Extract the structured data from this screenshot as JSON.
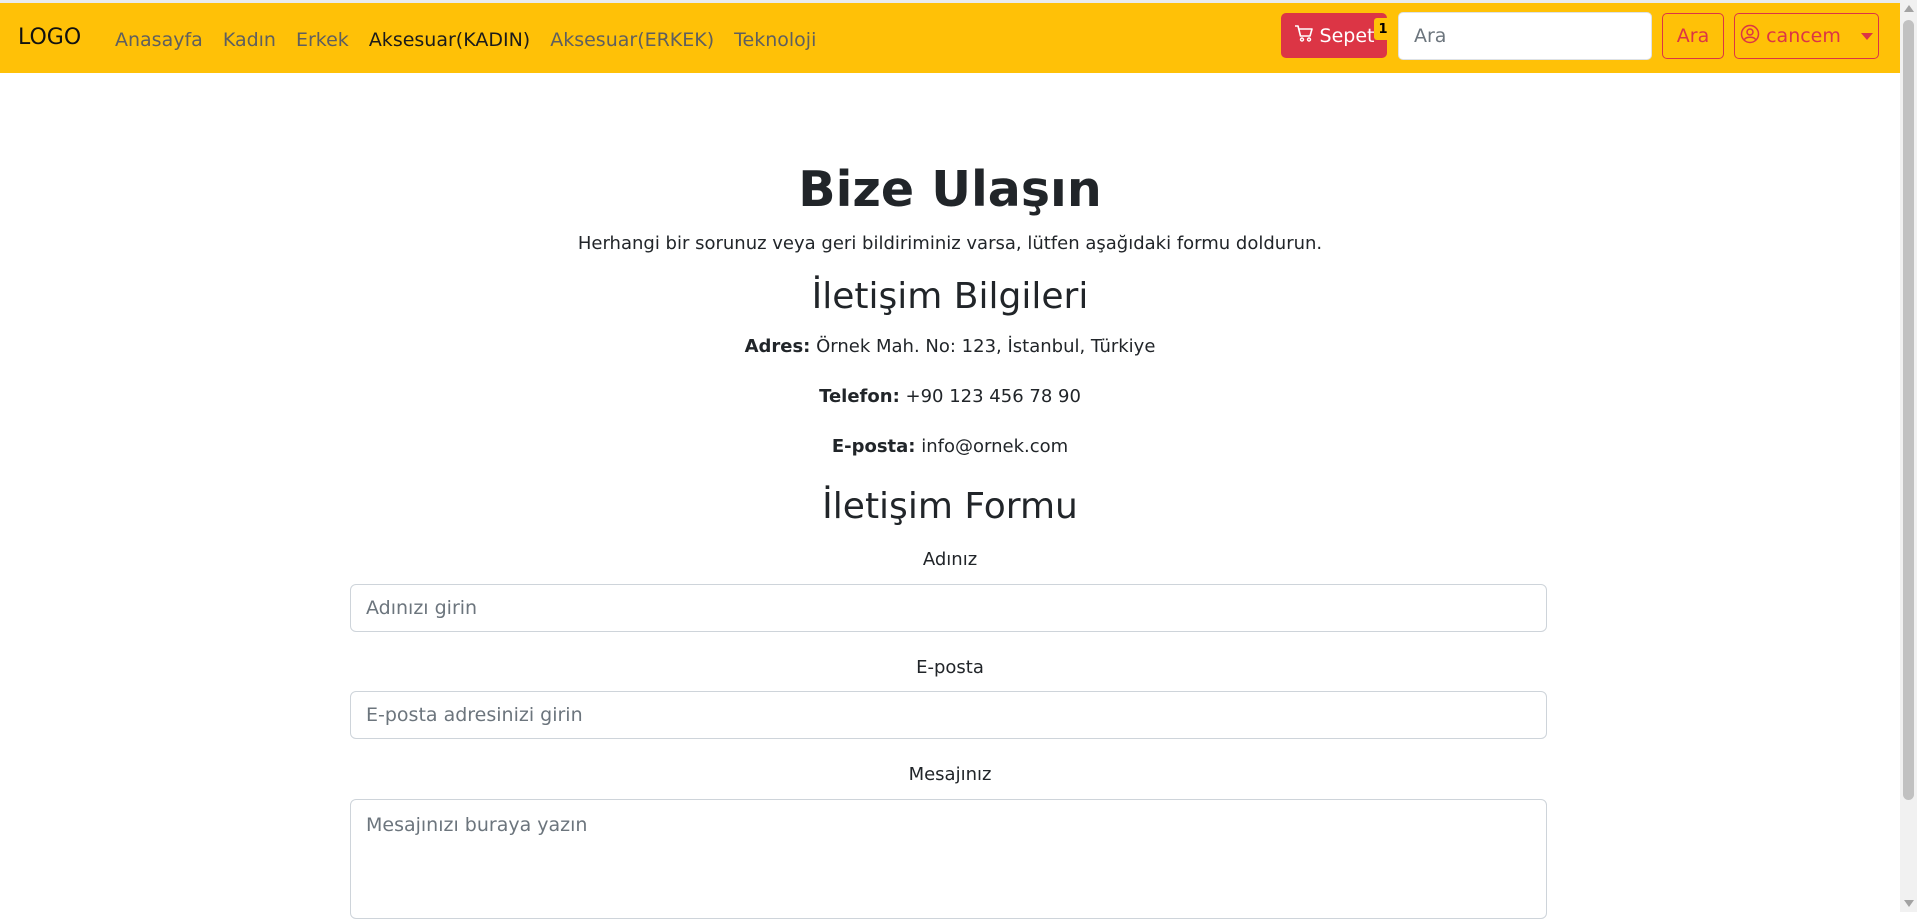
{
  "navbar": {
    "brand": "LOGO",
    "links": [
      {
        "label": "Anasayfa",
        "active": false
      },
      {
        "label": "Kadın",
        "active": false
      },
      {
        "label": "Erkek",
        "active": false
      },
      {
        "label": "Aksesuar(KADIN)",
        "active": true
      },
      {
        "label": "Aksesuar(ERKEK)",
        "active": false
      },
      {
        "label": "Teknoloji",
        "active": false
      }
    ],
    "cart_label": "Sepet",
    "cart_count": "1",
    "cart_icon": "cart-icon",
    "search_placeholder": "Ara",
    "search_button": "Ara",
    "user_label": "cancem",
    "user_icon": "user-circle-icon",
    "colors": {
      "navbar": "#ffc107",
      "accent": "#dc3545"
    }
  },
  "main": {
    "title": "Bize Ulaşın",
    "lead": "Herhangi bir sorunuz veya geri bildiriminiz varsa, lütfen aşağıdaki formu doldurun.",
    "contact": {
      "heading": "İletişim Bilgileri",
      "address_label": "Adres:",
      "address_value": "Örnek Mah. No: 123, İstanbul, Türkiye",
      "phone_label": "Telefon:",
      "phone_value": "+90 123 456 78 90",
      "email_label": "E-posta:",
      "email_value": "info@ornek.com"
    },
    "form": {
      "heading": "İletişim Formu",
      "name_label": "Adınız",
      "name_placeholder": "Adınızı girin",
      "email_label": "E-posta",
      "email_placeholder": "E-posta adresinizi girin",
      "message_label": "Mesajınız",
      "message_placeholder": "Mesajınızı buraya yazın"
    }
  }
}
